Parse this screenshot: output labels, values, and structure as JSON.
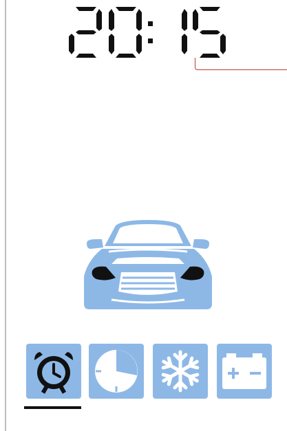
{
  "clock": {
    "time": "20:15",
    "hours": "20",
    "minutes": "15",
    "color": "#111111"
  },
  "vehicle": {
    "icon": "car-front-icon",
    "color": "#8db8e6"
  },
  "toolbar": {
    "accent_color": "#8db8e6",
    "active_tab": "alarm",
    "items": [
      {
        "id": "alarm",
        "icon": "alarm-clock-icon"
      },
      {
        "id": "timer",
        "icon": "timer-icon"
      },
      {
        "id": "climate",
        "icon": "snowflake-icon"
      },
      {
        "id": "battery",
        "icon": "battery-icon"
      }
    ]
  }
}
